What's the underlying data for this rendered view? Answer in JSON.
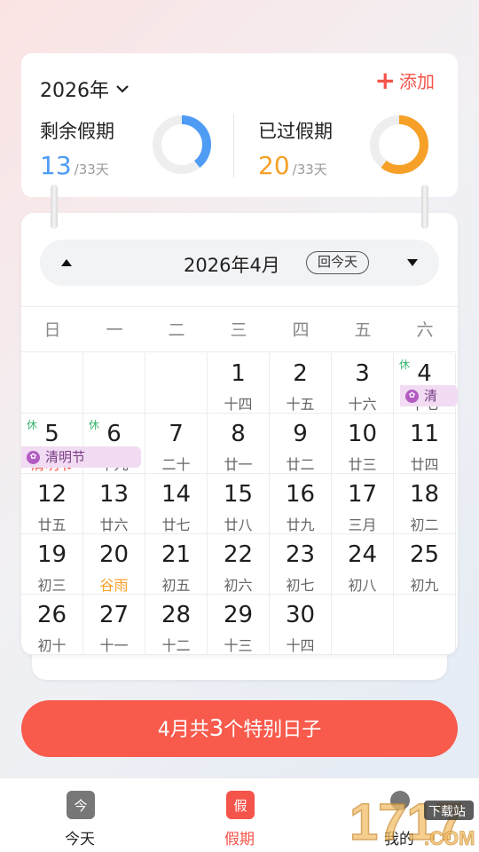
{
  "summary": {
    "year_label": "2026年",
    "add_label": "添加",
    "remaining": {
      "label": "剩余假期",
      "value": "13",
      "total": "/33天",
      "fraction": 0.394,
      "color": "#4f9cf5"
    },
    "used": {
      "label": "已过假期",
      "value": "20",
      "total": "/33天",
      "fraction": 0.606,
      "color": "#f6a028"
    }
  },
  "calendar": {
    "month_title": "2026年4月",
    "today_label": "回今天",
    "weekdays": [
      "日",
      "一",
      "二",
      "三",
      "四",
      "五",
      "六"
    ],
    "rest_label": "休",
    "holiday_name": "清明节",
    "holiday_short": "清",
    "weeks": [
      [
        null,
        null,
        null,
        {
          "num": "1",
          "lunar": "十四"
        },
        {
          "num": "2",
          "lunar": "十五"
        },
        {
          "num": "3",
          "lunar": "十六"
        },
        {
          "num": "4",
          "lunar": "十七",
          "rest": true
        }
      ],
      [
        {
          "num": "5",
          "lunar": "清明节",
          "rest": true,
          "kind": "holiday"
        },
        {
          "num": "6",
          "lunar": "十九",
          "rest": true
        },
        {
          "num": "7",
          "lunar": "二十"
        },
        {
          "num": "8",
          "lunar": "廿一"
        },
        {
          "num": "9",
          "lunar": "廿二"
        },
        {
          "num": "10",
          "lunar": "廿三"
        },
        {
          "num": "11",
          "lunar": "廿四"
        }
      ],
      [
        {
          "num": "12",
          "lunar": "廿五"
        },
        {
          "num": "13",
          "lunar": "廿六"
        },
        {
          "num": "14",
          "lunar": "廿七"
        },
        {
          "num": "15",
          "lunar": "廿八"
        },
        {
          "num": "16",
          "lunar": "廿九"
        },
        {
          "num": "17",
          "lunar": "三月"
        },
        {
          "num": "18",
          "lunar": "初二"
        }
      ],
      [
        {
          "num": "19",
          "lunar": "初三"
        },
        {
          "num": "20",
          "lunar": "谷雨",
          "kind": "term"
        },
        {
          "num": "21",
          "lunar": "初五"
        },
        {
          "num": "22",
          "lunar": "初六"
        },
        {
          "num": "23",
          "lunar": "初七"
        },
        {
          "num": "24",
          "lunar": "初八"
        },
        {
          "num": "25",
          "lunar": "初九"
        }
      ],
      [
        {
          "num": "26",
          "lunar": "初十"
        },
        {
          "num": "27",
          "lunar": "十一"
        },
        {
          "num": "28",
          "lunar": "十二"
        },
        {
          "num": "29",
          "lunar": "十三"
        },
        {
          "num": "30",
          "lunar": "十四"
        },
        null,
        null
      ]
    ]
  },
  "special_days": {
    "prefix": "4月共",
    "count": "3",
    "suffix": "个特别日子"
  },
  "tabs": [
    {
      "label": "今天",
      "icon_text": "今",
      "icon": "calendar-today-icon",
      "color": "#777777",
      "active": false
    },
    {
      "label": "假期",
      "icon_text": "假",
      "icon": "holiday-calendar-icon",
      "color": "#f4544a",
      "active": true
    },
    {
      "label": "我的",
      "icon_text": "",
      "icon": "profile-icon",
      "color": "#777777",
      "active": false
    }
  ],
  "watermark": {
    "digits": "1717",
    "small": "下载站",
    "domain": ".COM"
  }
}
